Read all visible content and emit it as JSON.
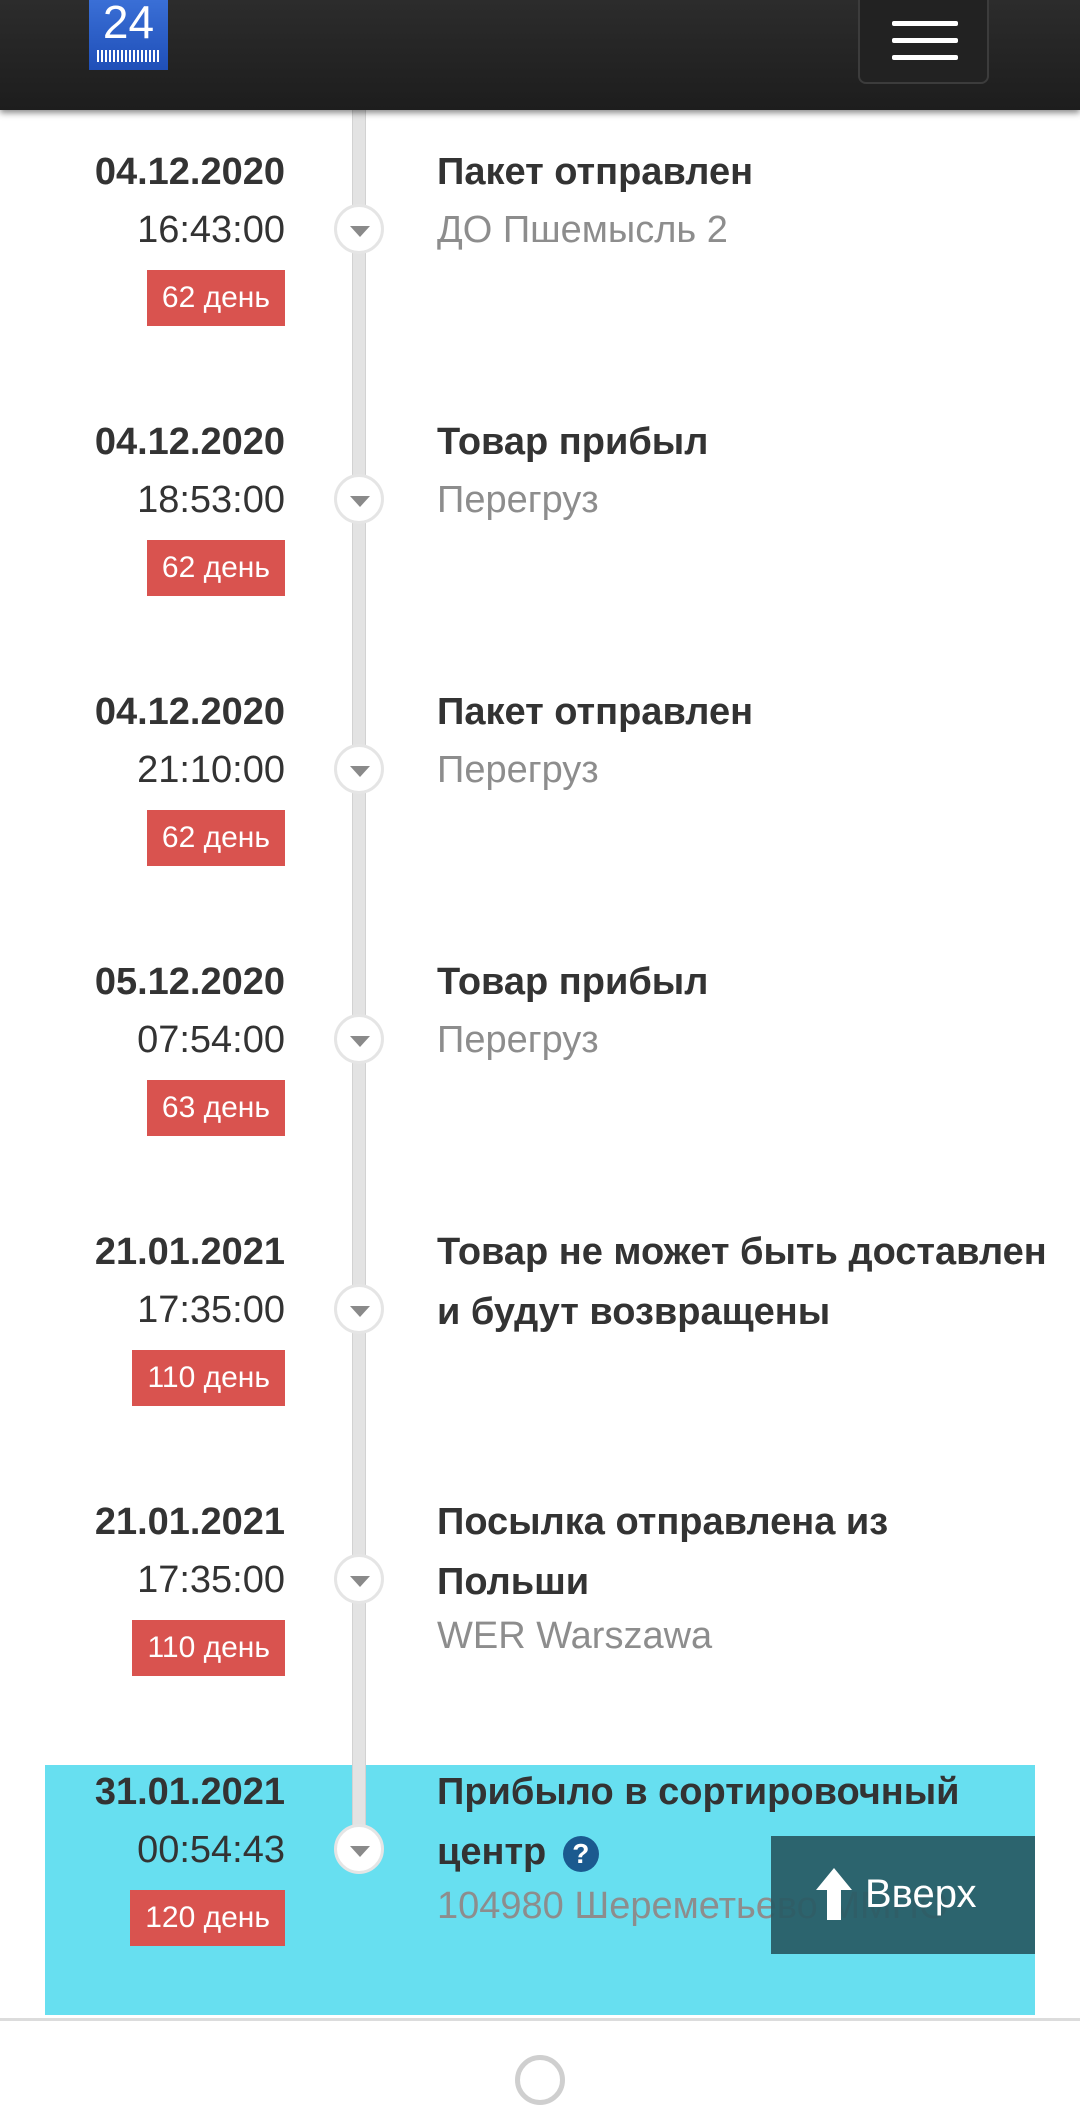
{
  "header": {
    "logo_text": "24",
    "menu_icon": "hamburger-icon"
  },
  "events": [
    {
      "date": "04.12.2020",
      "time": "16:43:00",
      "days": "62 день",
      "title": "Пакет отправлен",
      "location": "ДО Пшемысль 2"
    },
    {
      "date": "04.12.2020",
      "time": "18:53:00",
      "days": "62 день",
      "title": "Товар прибыл",
      "location": "Перегруз"
    },
    {
      "date": "04.12.2020",
      "time": "21:10:00",
      "days": "62 день",
      "title": "Пакет отправлен",
      "location": "Перегруз"
    },
    {
      "date": "05.12.2020",
      "time": "07:54:00",
      "days": "63 день",
      "title": "Товар прибыл",
      "location": "Перегруз"
    },
    {
      "date": "21.01.2021",
      "time": "17:35:00",
      "days": "110 день",
      "title": "Товар не может быть доставлен и будут возвращены",
      "location": ""
    },
    {
      "date": "21.01.2021",
      "time": "17:35:00",
      "days": "110 день",
      "title": "Посылка отправлена из Польши",
      "location": "WER Warszawa"
    },
    {
      "date": "31.01.2021",
      "time": "00:54:43",
      "days": "120 день",
      "title": "Прибыло в сортировочный центр",
      "location": "104980 Шереметьево ММПО",
      "help_icon": "question-circle-icon"
    }
  ],
  "scroll_top_button": {
    "label": "Вверх",
    "icon": "arrow-up-icon"
  },
  "colors": {
    "header_bg": "#222222",
    "badge_bg": "#d9534f",
    "highlight_bg": "#67dff0",
    "scroll_button_bg": "#285a64",
    "help_icon_bg": "#1b5a8f"
  }
}
